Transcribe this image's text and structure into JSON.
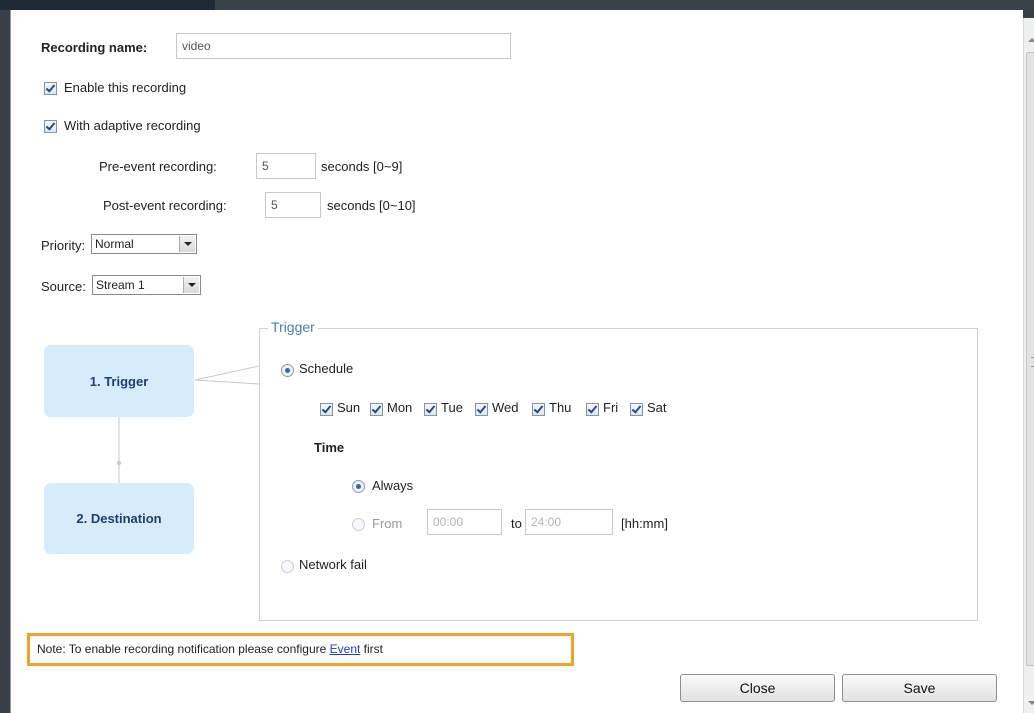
{
  "recording_name": {
    "label": "Recording name:",
    "value": "video"
  },
  "enable_recording": {
    "label": "Enable this recording",
    "checked": true
  },
  "adaptive_recording": {
    "label": "With adaptive recording",
    "checked": true
  },
  "pre_event": {
    "label": "Pre-event recording:",
    "value": "5",
    "suffix": "seconds [0~9]"
  },
  "post_event": {
    "label": "Post-event recording:",
    "value": "5",
    "suffix": "seconds [0~10]"
  },
  "priority": {
    "label": "Priority:",
    "value": "Normal"
  },
  "source": {
    "label": "Source:",
    "value": "Stream 1"
  },
  "steps": [
    {
      "label": "1. Trigger"
    },
    {
      "label": "2. Destination"
    }
  ],
  "trigger": {
    "legend": "Trigger",
    "schedule_label": "Schedule",
    "days": [
      "Sun",
      "Mon",
      "Tue",
      "Wed",
      "Thu",
      "Fri",
      "Sat"
    ],
    "time_label": "Time",
    "always_label": "Always",
    "from_label": "From",
    "from_value": "00:00",
    "to_label": "to",
    "to_value": "24:00",
    "format": "[hh:mm]",
    "network_fail_label": "Network fail"
  },
  "note": {
    "prefix": "Note: To enable recording notification please configure ",
    "link": "Event",
    "suffix": " first"
  },
  "buttons": {
    "close": "Close",
    "save": "Save"
  },
  "colors": {
    "accent_border": "#f2a22b",
    "step_bg": "#d7ecfa",
    "legend": "#4a7fb5",
    "link": "#1f3ec8"
  }
}
